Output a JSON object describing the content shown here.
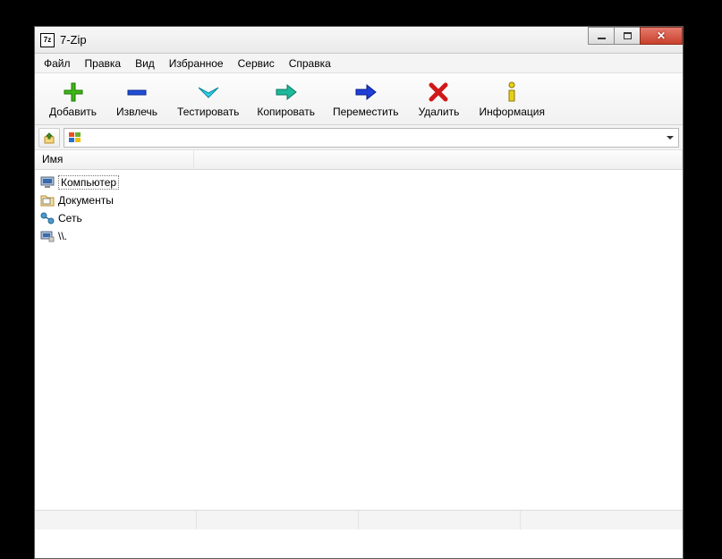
{
  "window": {
    "title": "7-Zip"
  },
  "menu": {
    "file": "Файл",
    "edit": "Правка",
    "view": "Вид",
    "favorites": "Избранное",
    "tools": "Сервис",
    "help": "Справка"
  },
  "toolbar": {
    "add": "Добавить",
    "extract": "Извлечь",
    "test": "Тестировать",
    "copy": "Копировать",
    "move": "Переместить",
    "delete": "Удалить",
    "info": "Информация"
  },
  "columns": {
    "name": "Имя"
  },
  "items": [
    {
      "label": "Компьютер",
      "icon": "computer"
    },
    {
      "label": "Документы",
      "icon": "documents"
    },
    {
      "label": "Сеть",
      "icon": "network"
    },
    {
      "label": "\\\\.",
      "icon": "unc"
    }
  ]
}
